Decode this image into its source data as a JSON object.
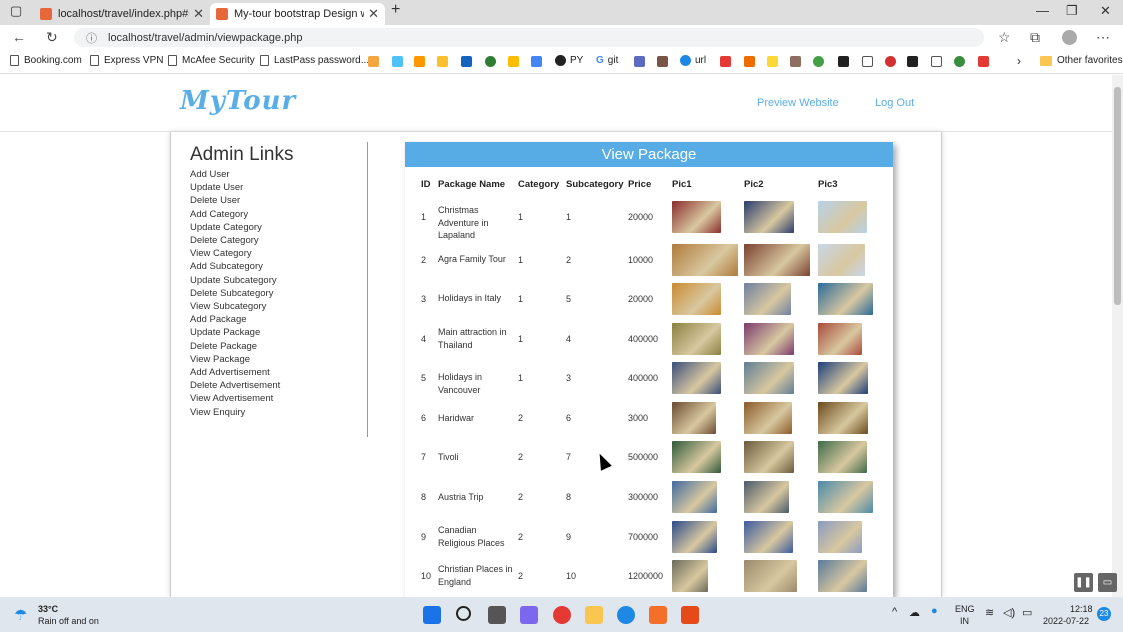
{
  "browser": {
    "tabs": [
      {
        "title": "localhost/travel/index.php#secti"
      },
      {
        "title": "My-tour bootstrap Design websi"
      }
    ],
    "url": "localhost/travel/admin/viewpackage.php",
    "url_prefix": "ⓘ"
  },
  "bookmarks": {
    "items": [
      "Booking.com",
      "Express VPN",
      "McAfee Security",
      "LastPass password...",
      "PY",
      "git",
      "url"
    ],
    "other": "Other favorites"
  },
  "site": {
    "logo": "MyTour",
    "nav": {
      "preview": "Preview Website",
      "logout": "Log Out"
    }
  },
  "admin": {
    "title": "Admin Links",
    "links": [
      "Add User",
      "Update User",
      "Delete User",
      "Add Category",
      "Update Category",
      "Delete Category",
      "View Category",
      "Add Subcategory",
      "Update Subcategory",
      "Delete Subcategory",
      "View Subcategory",
      "Add Package",
      "Update Package",
      "Delete Package",
      "View Package",
      "Add Advertisement",
      "Delete Advertisement",
      "View Advertisement",
      "View Enquiry"
    ]
  },
  "panel": {
    "title": "View Package"
  },
  "table": {
    "headers": [
      "ID",
      "Package Name",
      "Category",
      "Subcategory",
      "Price",
      "Pic1",
      "Pic2",
      "Pic3"
    ],
    "rows": [
      {
        "id": "1",
        "name": "Christmas Adventure in Lapaland",
        "cat": "1",
        "sub": "1",
        "price": "20000"
      },
      {
        "id": "2",
        "name": "Agra Family Tour",
        "cat": "1",
        "sub": "2",
        "price": "10000"
      },
      {
        "id": "3",
        "name": "Holidays in Italy",
        "cat": "1",
        "sub": "5",
        "price": "20000"
      },
      {
        "id": "4",
        "name": "Main attraction in Thailand",
        "cat": "1",
        "sub": "4",
        "price": "400000"
      },
      {
        "id": "5",
        "name": "Holidays in Vancouver",
        "cat": "1",
        "sub": "3",
        "price": "400000"
      },
      {
        "id": "6",
        "name": "Haridwar",
        "cat": "2",
        "sub": "6",
        "price": "3000"
      },
      {
        "id": "7",
        "name": "Tivoli",
        "cat": "2",
        "sub": "7",
        "price": "500000"
      },
      {
        "id": "8",
        "name": "Austria Trip",
        "cat": "2",
        "sub": "8",
        "price": "300000"
      },
      {
        "id": "9",
        "name": "Canadian Religious Places",
        "cat": "2",
        "sub": "9",
        "price": "700000"
      },
      {
        "id": "10",
        "name": "Christian Places in England",
        "cat": "2",
        "sub": "10",
        "price": "1200000"
      }
    ]
  },
  "taskbar": {
    "weather_temp": "33°C",
    "weather_text": "Rain off and on",
    "lang1": "ENG",
    "lang2": "IN",
    "time": "12:18",
    "date": "2022-07-22",
    "badge": "23"
  },
  "colors": {
    "accent": "#58ace5"
  }
}
